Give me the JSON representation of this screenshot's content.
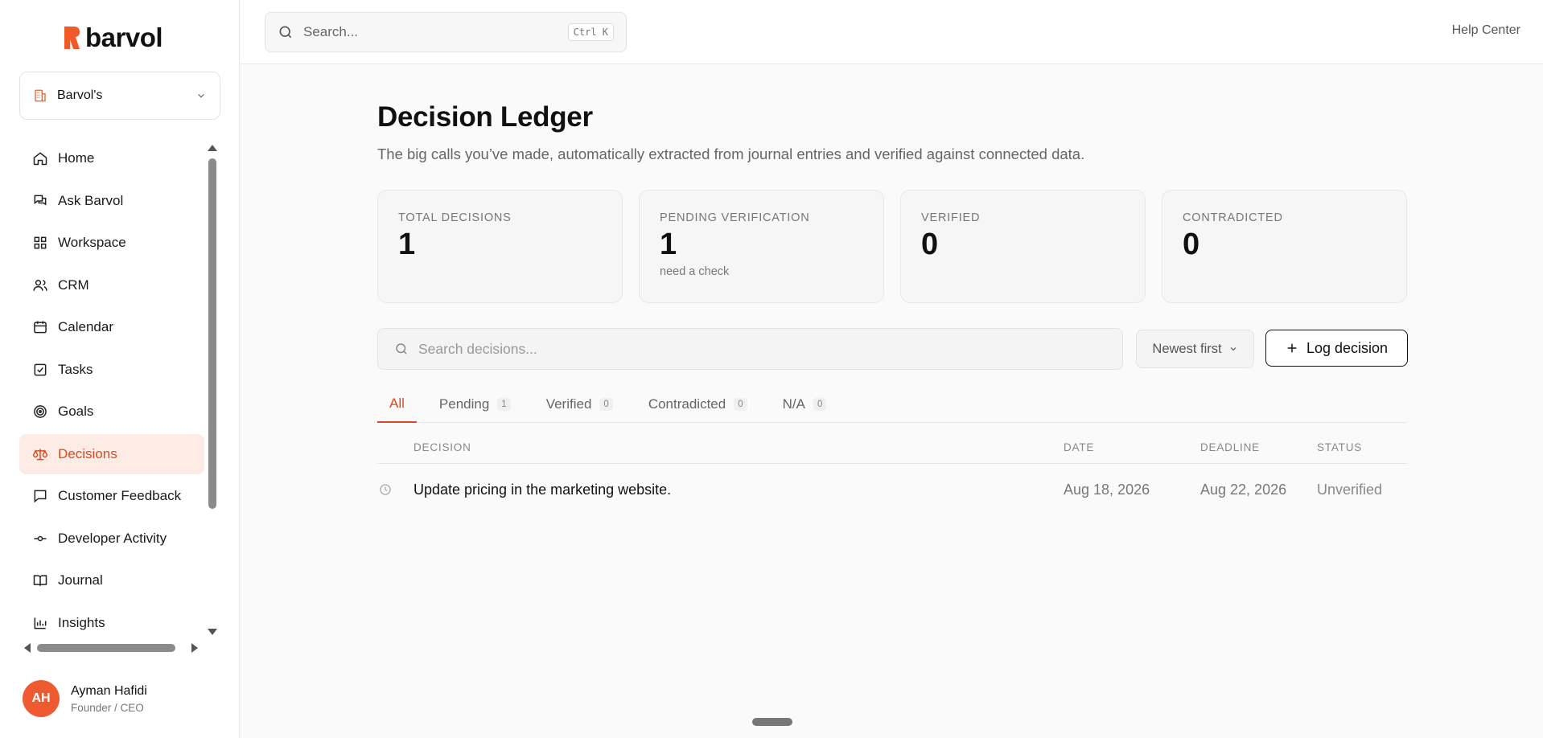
{
  "brand": {
    "name": "barvol",
    "color": "#f05a28"
  },
  "org": {
    "label": "Barvol's"
  },
  "topbar": {
    "search_placeholder": "Search...",
    "shortcut": "Ctrl K",
    "help_label": "Help Center"
  },
  "sidebar": {
    "items": [
      {
        "label": "Home",
        "icon": "home-icon"
      },
      {
        "label": "Ask Barvol",
        "icon": "chat-icon"
      },
      {
        "label": "Workspace",
        "icon": "grid-icon"
      },
      {
        "label": "CRM",
        "icon": "users-icon"
      },
      {
        "label": "Calendar",
        "icon": "calendar-icon"
      },
      {
        "label": "Tasks",
        "icon": "checkbox-icon"
      },
      {
        "label": "Goals",
        "icon": "target-icon"
      },
      {
        "label": "Decisions",
        "icon": "scale-icon",
        "active": true
      },
      {
        "label": "Customer Feedback",
        "icon": "message-square-icon"
      },
      {
        "label": "Developer Activity",
        "icon": "commit-icon"
      },
      {
        "label": "Journal",
        "icon": "book-icon"
      },
      {
        "label": "Insights",
        "icon": "bar-chart-icon"
      }
    ]
  },
  "user": {
    "initials": "AH",
    "name": "Ayman Hafidi",
    "role": "Founder / CEO"
  },
  "page": {
    "title": "Decision Ledger",
    "subtitle": "The big calls you’ve made, automatically extracted from journal entries and verified against connected data."
  },
  "stats": [
    {
      "label": "TOTAL DECISIONS",
      "value": "1"
    },
    {
      "label": "PENDING VERIFICATION",
      "value": "1",
      "note": "need a check"
    },
    {
      "label": "VERIFIED",
      "value": "0"
    },
    {
      "label": "CONTRADICTED",
      "value": "0"
    }
  ],
  "filters": {
    "search_placeholder": "Search decisions...",
    "sort_label": "Newest first",
    "log_label": "Log decision"
  },
  "tabs": [
    {
      "label": "All",
      "active": true
    },
    {
      "label": "Pending",
      "count": "1"
    },
    {
      "label": "Verified",
      "count": "0"
    },
    {
      "label": "Contradicted",
      "count": "0"
    },
    {
      "label": "N/A",
      "count": "0"
    }
  ],
  "table": {
    "headers": {
      "decision": "DECISION",
      "date": "DATE",
      "deadline": "DEADLINE",
      "status": "STATUS"
    },
    "rows": [
      {
        "decision": "Update pricing in the marketing website.",
        "date": "Aug 18, 2026",
        "deadline": "Aug 22, 2026",
        "status": "Unverified"
      }
    ]
  },
  "colors": {
    "accent": "#d84a22",
    "active_bg": "#fdece5",
    "avatar_bg": "#ef5a30"
  }
}
